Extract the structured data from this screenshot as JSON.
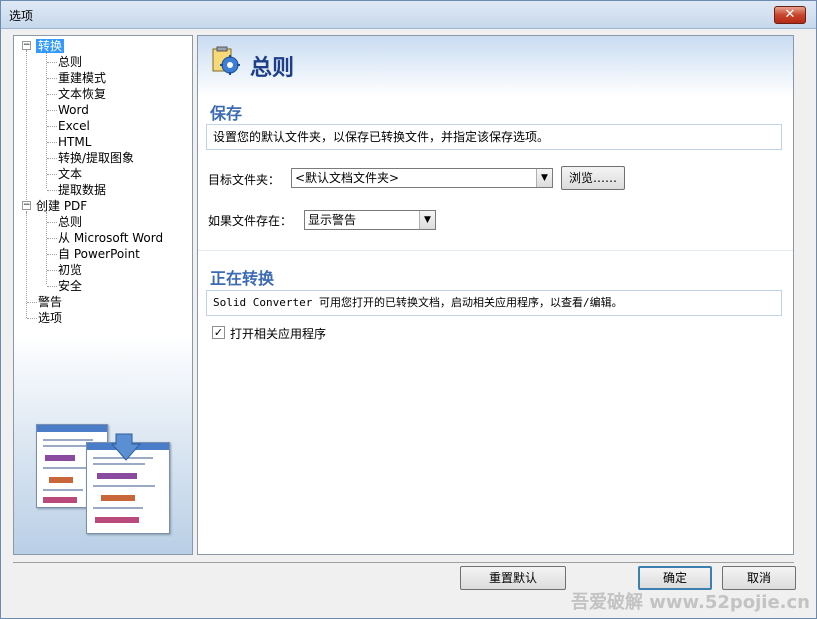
{
  "window": {
    "title": "选项",
    "close_glyph": "✕"
  },
  "tree": {
    "items": [
      {
        "label": "转换",
        "toggle": "−",
        "selected": true
      },
      {
        "label": "总则"
      },
      {
        "label": "重建模式"
      },
      {
        "label": "文本恢复"
      },
      {
        "label": "Word"
      },
      {
        "label": "Excel"
      },
      {
        "label": "HTML"
      },
      {
        "label": "转换/提取图象"
      },
      {
        "label": "文本"
      },
      {
        "label": "提取数据"
      },
      {
        "label": "创建 PDF",
        "toggle": "−"
      },
      {
        "label": "总则"
      },
      {
        "label": "从 Microsoft Word"
      },
      {
        "label": "自 PowerPoint"
      },
      {
        "label": "初览"
      },
      {
        "label": "安全"
      },
      {
        "label": "警告"
      },
      {
        "label": "选项"
      }
    ]
  },
  "header": {
    "title": "总则",
    "icon": "gear-clipboard-icon"
  },
  "save_section": {
    "title": "保存",
    "description": "设置您的默认文件夹，以保存已转换文件，并指定该保存选项。",
    "target_folder_label": "目标文件夹：",
    "target_folder_value": "<默认文档文件夹>",
    "browse_label": "浏览……",
    "if_exists_label": "如果文件存在：",
    "if_exists_value": "显示警告"
  },
  "converting_section": {
    "title": "正在转换",
    "description": "Solid Converter 可用您打开的已转换文档，启动相关应用程序，以查看/编辑。",
    "open_app_label": "打开相关应用程序",
    "open_app_checked": true
  },
  "footer": {
    "reset_label": "重置默认",
    "ok_label": "确定",
    "cancel_label": "取消"
  },
  "watermark": "吾爱破解 www.52pojie.cn"
}
